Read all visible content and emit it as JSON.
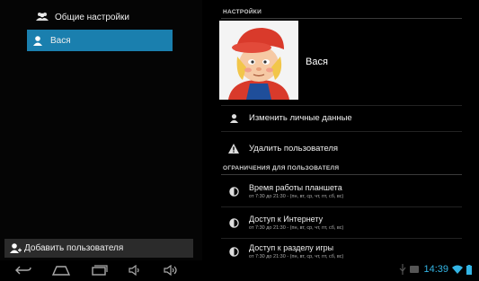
{
  "left": {
    "general_settings": "Общие настройки",
    "user_item": "Вася",
    "add_user": "Добавить пользователя"
  },
  "right": {
    "section_settings": "НАСТРОЙКИ",
    "user_name": "Вася",
    "edit_personal": "Изменить личные данные",
    "delete_user": "Удалить пользователя",
    "section_restrictions": "ОГРАНИЧЕНИЯ ДЛЯ ПОЛЬЗОВАТЕЛЯ",
    "restrictions": [
      {
        "title": "Время работы планшета",
        "subtitle": "от 7:30 до 21:30 - (пн, вт, ср, чт, пт, сб, вс)"
      },
      {
        "title": "Доступ к Интернету",
        "subtitle": "от 7:30 до 21:30 - (пн, вт, ср, чт, пт, сб, вс)"
      },
      {
        "title": "Доступ к разделу игры",
        "subtitle": "от 7:30 до 21:30 - (пн, вт, ср, чт, пт, сб, вс)"
      }
    ]
  },
  "status": {
    "time": "14:39",
    "accent": "#33b5e5",
    "selected_bg": "#1a7fae"
  }
}
